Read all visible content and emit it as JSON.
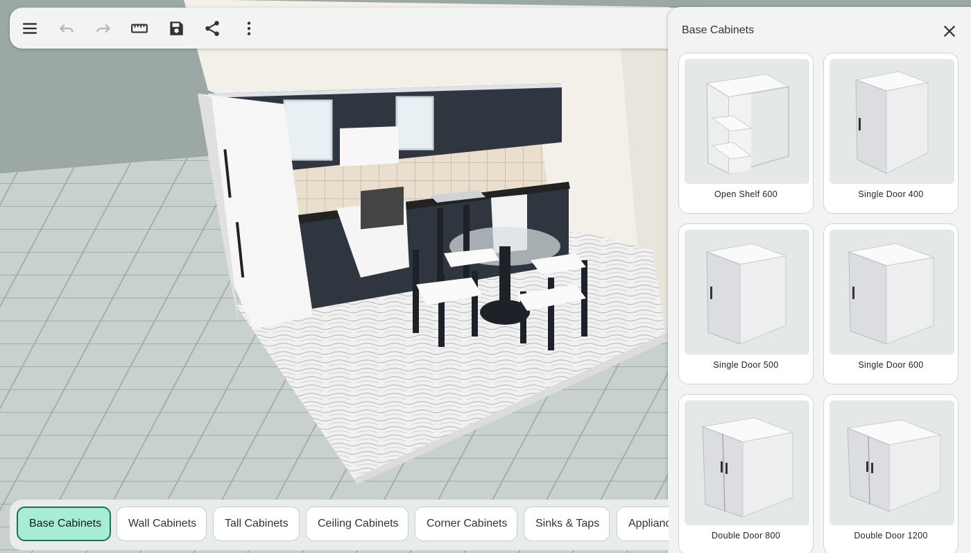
{
  "toolbar": {
    "buttons": [
      {
        "name": "menu",
        "icon": "menu-icon"
      },
      {
        "name": "undo",
        "icon": "undo-icon"
      },
      {
        "name": "redo",
        "icon": "redo-icon"
      },
      {
        "name": "measure",
        "icon": "ruler-icon"
      },
      {
        "name": "save",
        "icon": "save-icon"
      },
      {
        "name": "share",
        "icon": "share-icon"
      },
      {
        "name": "more",
        "icon": "more-vertical-icon"
      }
    ]
  },
  "panel": {
    "title": "Base Cabinets",
    "close_icon": "close-icon",
    "items": [
      {
        "label": "Open Shelf 600",
        "kind": "open-shelf"
      },
      {
        "label": "Single Door 400",
        "kind": "single-door"
      },
      {
        "label": "Single Door 500",
        "kind": "single-door"
      },
      {
        "label": "Single Door 600",
        "kind": "single-door"
      },
      {
        "label": "Double Door 800",
        "kind": "double-door"
      },
      {
        "label": "Double Door 1200",
        "kind": "double-door"
      }
    ]
  },
  "categories": {
    "active_index": 0,
    "items": [
      "Base Cabinets",
      "Wall Cabinets",
      "Tall Cabinets",
      "Ceiling Cabinets",
      "Corner Cabinets",
      "Sinks & Taps",
      "Appliances"
    ]
  },
  "colors": {
    "accent": "#a6ecd6",
    "accent_border": "#1e6d55",
    "cabinet_dark": "#2f3640",
    "floor_tile": "#c3ccc8"
  }
}
